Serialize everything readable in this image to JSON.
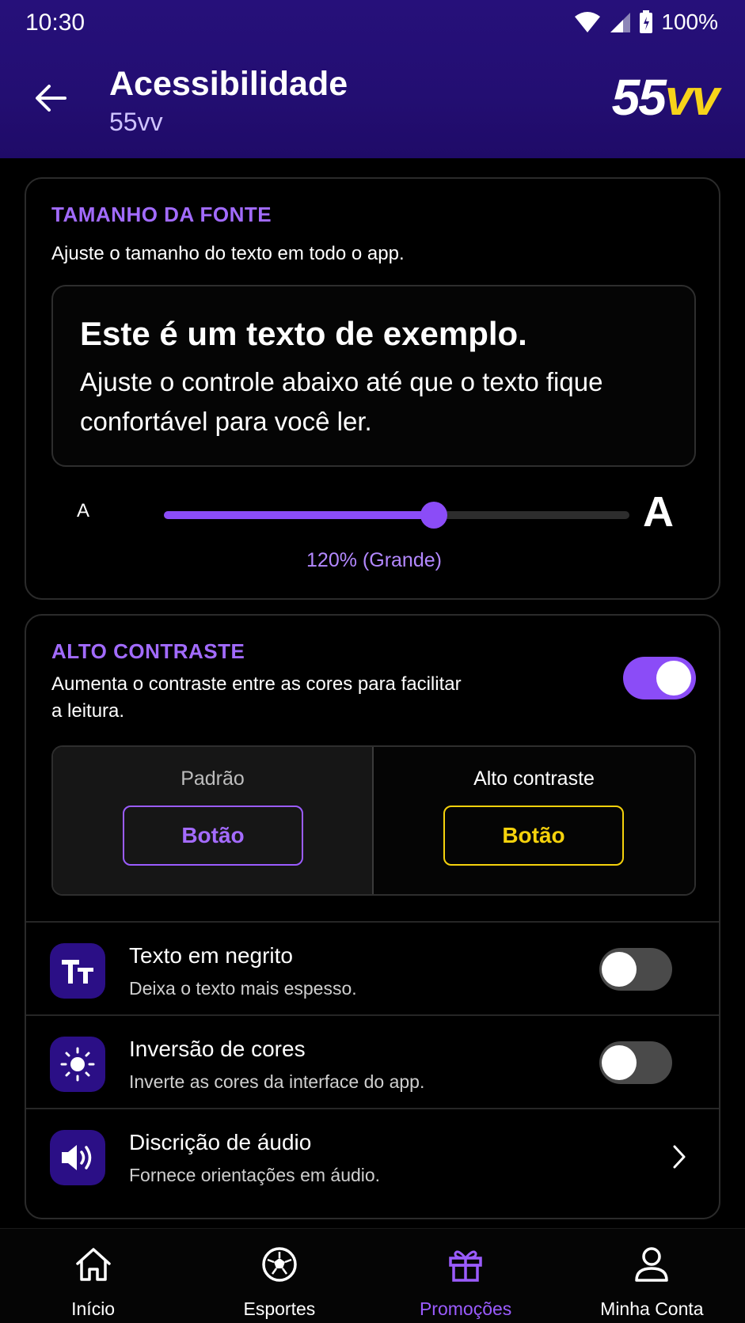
{
  "status": {
    "time": "10:30",
    "battery": "100%"
  },
  "header": {
    "title": "Acessibilidade",
    "subtitle": "55vv",
    "brand_white": "55",
    "brand_yellow": "vv"
  },
  "font_size": {
    "title": "TAMANHO DA FONTE",
    "description": "Ajuste o tamanho do texto em todo o app.",
    "preview_title": "Este é um texto de exemplo.",
    "preview_body": "Ajuste o controle abaixo até que o texto fique confortável para você ler.",
    "small_a": "A",
    "large_a": "A",
    "slider_fraction": 0.58,
    "value_label": "120% (Grande)"
  },
  "contrast": {
    "title": "ALTO CONTRASTE",
    "description": "Aumenta o contraste entre as cores para facilitar a leitura.",
    "enabled": true,
    "standard_label": "Padrão",
    "standard_button": "Botão",
    "high_label": "Alto contraste",
    "high_button": "Botão"
  },
  "options": [
    {
      "title": "Texto em negrito",
      "subtitle": "Deixa o texto mais espesso.",
      "icon": "text-size-icon",
      "enabled": false
    },
    {
      "title": "Inversão de cores",
      "subtitle": "Inverte as cores da interface do app.",
      "icon": "brightness-icon",
      "enabled": false
    },
    {
      "title": "Discrição de áudio",
      "subtitle": "Fornece orientações em áudio.",
      "icon": "speaker-icon"
    }
  ],
  "nav": [
    {
      "label": "Início",
      "icon": "home-icon",
      "active": false
    },
    {
      "label": "Esportes",
      "icon": "soccer-ball-icon",
      "active": false
    },
    {
      "label": "Promoções",
      "icon": "gift-icon",
      "active": true
    },
    {
      "label": "Minha Conta",
      "icon": "user-icon",
      "active": false
    }
  ],
  "colors": {
    "accent": "#8b4cf7",
    "header": "#230e72",
    "highlight_yellow": "#f5d20c"
  }
}
